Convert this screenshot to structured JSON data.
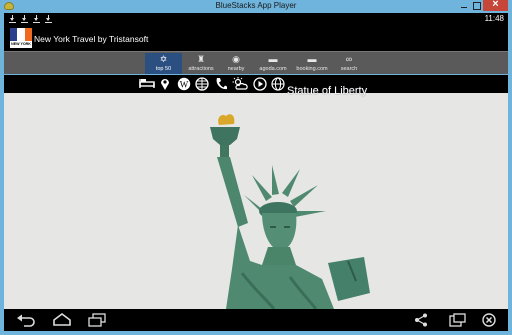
{
  "window": {
    "title": "BlueStacks App Player",
    "app_icon": "bluestacks-icon",
    "controls": [
      "minimize-icon",
      "maximize-icon",
      "close-icon"
    ],
    "frame_color": "#6fb4dc"
  },
  "status_bar": {
    "icons": [
      "download-icon",
      "download-icon",
      "download-icon",
      "download-icon"
    ],
    "time": "11:48"
  },
  "app": {
    "title": "New York Travel by Tristansoft",
    "logo_text": "NEW YORK",
    "logo_colors": [
      "#2a3f8e",
      "#ffffff",
      "#ef6b22"
    ]
  },
  "tabs": [
    {
      "label": "top 50",
      "icon": "star-icon",
      "active": true
    },
    {
      "label": "attractions",
      "icon": "attractions-icon",
      "active": false
    },
    {
      "label": "nearby",
      "icon": "nearby-signal-icon",
      "active": false
    },
    {
      "label": "agoda.com",
      "icon": "bed-icon",
      "active": false
    },
    {
      "label": "booking.com",
      "icon": "bed-icon",
      "active": false
    },
    {
      "label": "search",
      "icon": "binoculars-icon",
      "active": false
    }
  ],
  "actions": [
    "hotel-bed-icon",
    "map-pin-icon",
    "wikipedia-icon",
    "globe-grid-icon",
    "phone-icon",
    "weather-icon",
    "play-icon",
    "web-icon"
  ],
  "place": {
    "name": "Statue of Liberty"
  },
  "colors": {
    "active_tab": "#2b4f80",
    "tab_bar": "#5a5a5a",
    "sky": "#e6e6e5",
    "statue": "#4f8a70"
  },
  "nav_bar": [
    "back-icon",
    "home-icon",
    "recent-apps-icon",
    "share-icon",
    "screen-rotate-icon",
    "exit-icon"
  ]
}
